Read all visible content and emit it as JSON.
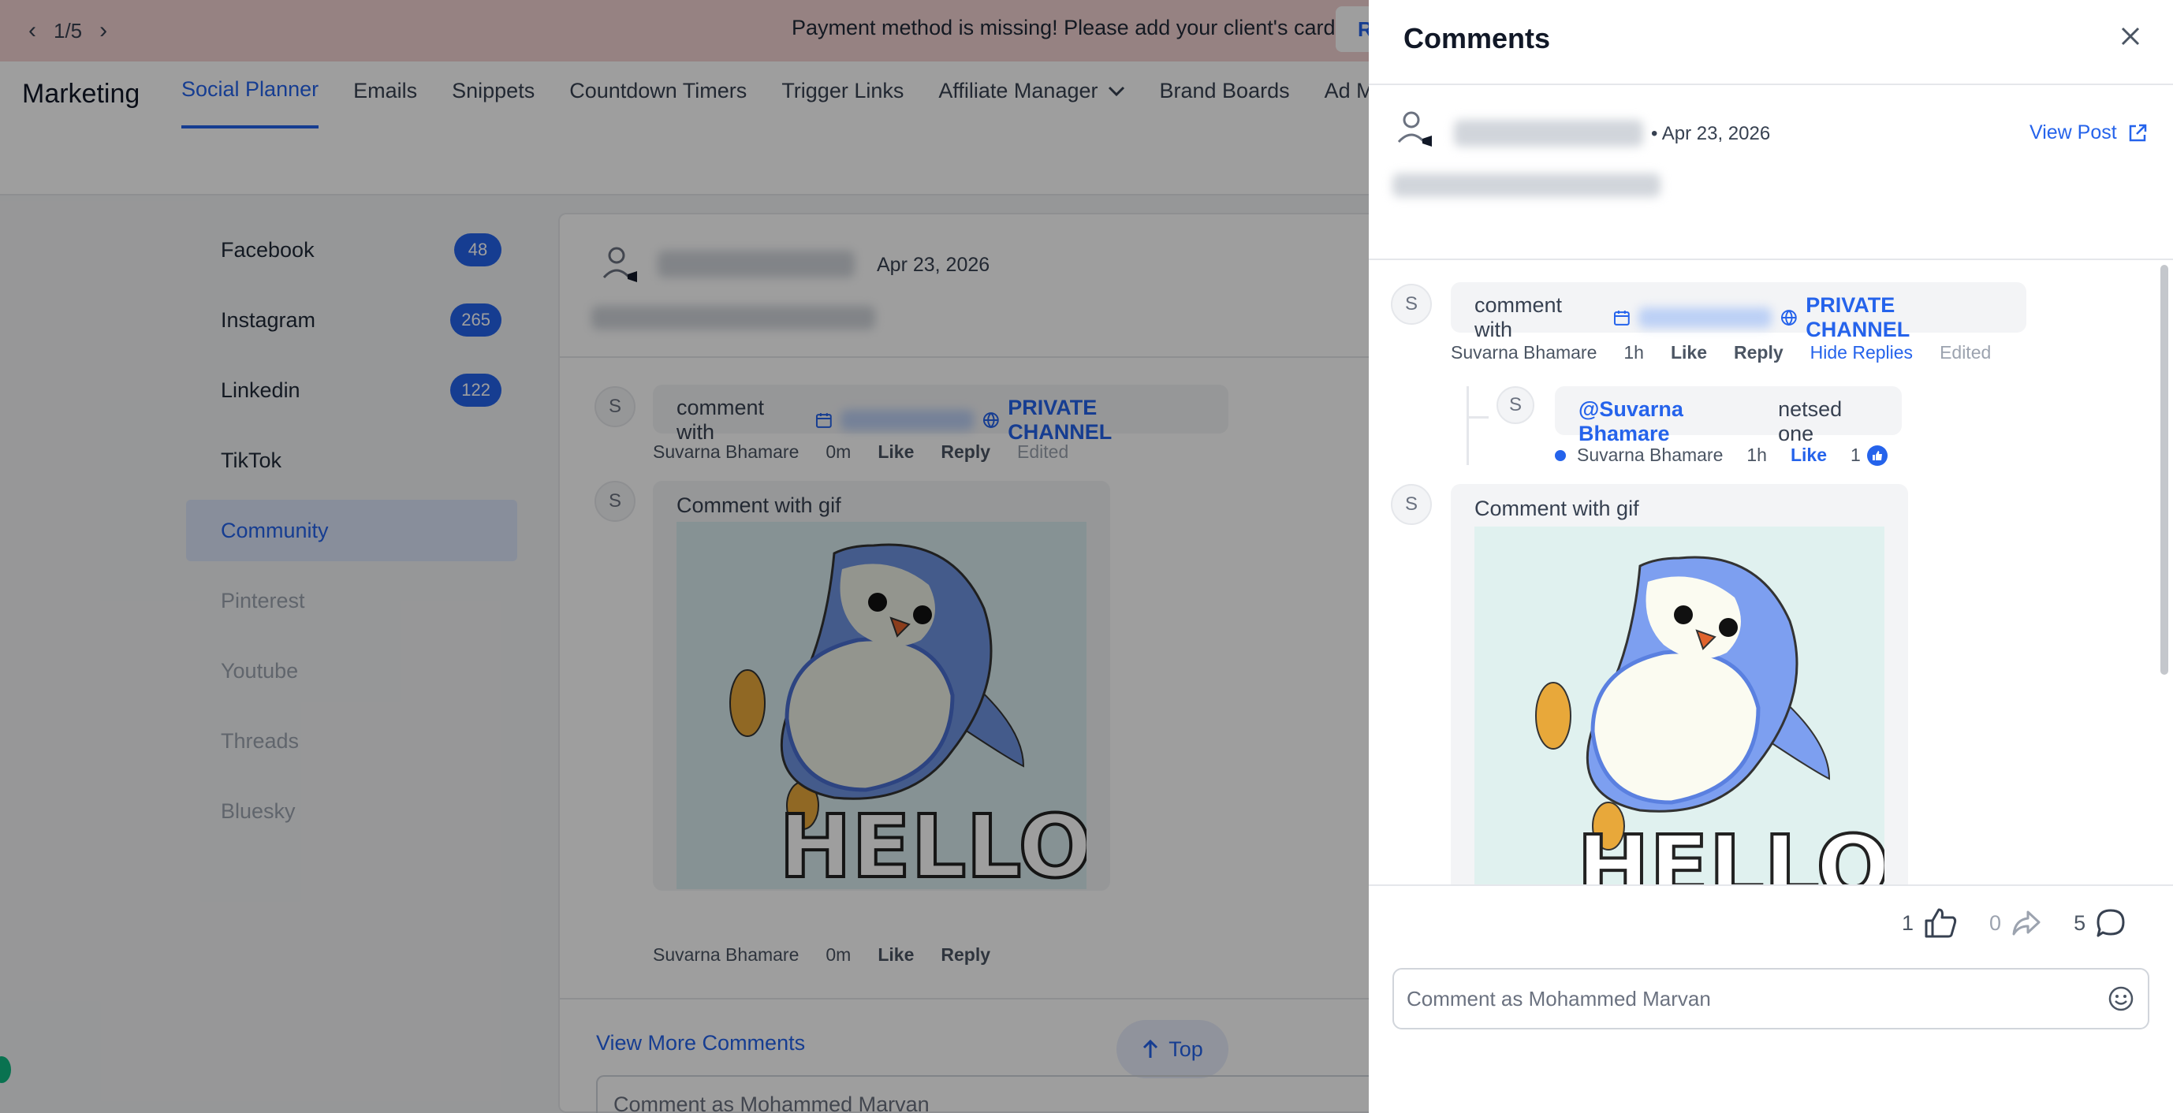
{
  "banner": {
    "pager": "1/5",
    "message": "Payment method is missing! Please add your client's card.",
    "button_label": "R"
  },
  "nav": {
    "title": "Marketing",
    "tabs": [
      "Social Planner",
      "Emails",
      "Snippets",
      "Countdown Timers",
      "Trigger Links",
      "Affiliate Manager",
      "Brand Boards",
      "Ad Mar"
    ]
  },
  "sidebar": {
    "items": [
      {
        "label": "Facebook",
        "count": "48"
      },
      {
        "label": "Instagram",
        "count": "265"
      },
      {
        "label": "Linkedin",
        "count": "122"
      },
      {
        "label": "TikTok"
      },
      {
        "label": "Community"
      },
      {
        "label": "Pinterest"
      },
      {
        "label": "Youtube"
      },
      {
        "label": "Threads"
      },
      {
        "label": "Bluesky"
      }
    ]
  },
  "feed": {
    "post_date": "Apr 23, 2026",
    "comment1": {
      "initial": "S",
      "text": "comment with",
      "channel": "PRIVATE CHANNEL",
      "author": "Suvarna Bhamare",
      "time": "0m",
      "like": "Like",
      "reply": "Reply",
      "edited": "Edited"
    },
    "comment2": {
      "initial": "S",
      "text": "Comment with gif",
      "author": "Suvarna Bhamare",
      "time": "0m",
      "like": "Like",
      "reply": "Reply"
    },
    "view_more": "View More Comments",
    "top_button": "Top",
    "input_placeholder": "Comment as Mohammed Marvan"
  },
  "panel": {
    "title": "Comments",
    "post_date": "Apr 23, 2026",
    "view_post": "View Post",
    "comment1": {
      "initial": "S",
      "text": "comment with",
      "channel": "PRIVATE CHANNEL",
      "author": "Suvarna Bhamare",
      "time": "1h",
      "like": "Like",
      "reply": "Reply",
      "hide_replies": "Hide Replies",
      "edited": "Edited"
    },
    "reply1": {
      "initial": "S",
      "mention": "@Suvarna Bhamare",
      "text": "netsed one",
      "author": "Suvarna Bhamare",
      "time": "1h",
      "like": "Like",
      "like_count": "1"
    },
    "comment2": {
      "initial": "S",
      "text": "Comment with gif"
    },
    "stats": {
      "likes": "1",
      "shares": "0",
      "comments": "5"
    },
    "input_placeholder": "Comment as Mohammed Marvan"
  },
  "colors": {
    "accent": "#2563eb",
    "banner_bg": "#f2d2d2",
    "active_side_bg": "#dbe6fb"
  }
}
